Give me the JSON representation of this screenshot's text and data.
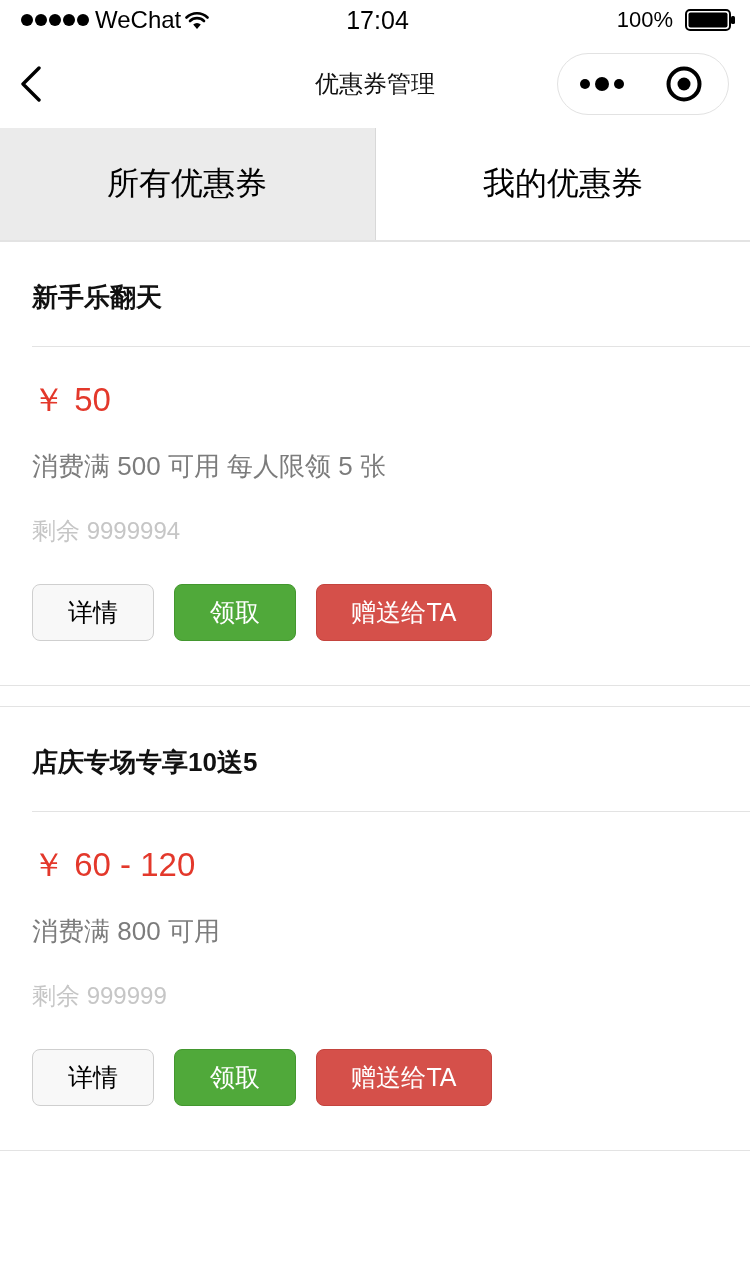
{
  "status_bar": {
    "carrier": "WeChat",
    "time": "17:04",
    "battery": "100%"
  },
  "nav_bar": {
    "title": "优惠券管理"
  },
  "tabs": [
    {
      "label": "所有优惠券",
      "selected": true
    },
    {
      "label": "我的优惠券",
      "selected": false
    }
  ],
  "coupons": [
    {
      "title": "新手乐翻天",
      "price": "￥ 50",
      "condition": "消费满 500 可用 每人限领 5 张",
      "remaining": "剩余 9999994",
      "buttons": [
        {
          "label": "详情",
          "kind": "default"
        },
        {
          "label": "领取",
          "kind": "primary"
        },
        {
          "label": "赠送给TA",
          "kind": "warn"
        }
      ]
    },
    {
      "title": "店庆专场专享10送5",
      "price": "￥ 60 - 120",
      "condition": "消费满 800 可用",
      "remaining": "剩余 999999",
      "buttons": [
        {
          "label": "详情",
          "kind": "default"
        },
        {
          "label": "领取",
          "kind": "primary"
        },
        {
          "label": "赠送给TA",
          "kind": "warn"
        }
      ]
    }
  ]
}
